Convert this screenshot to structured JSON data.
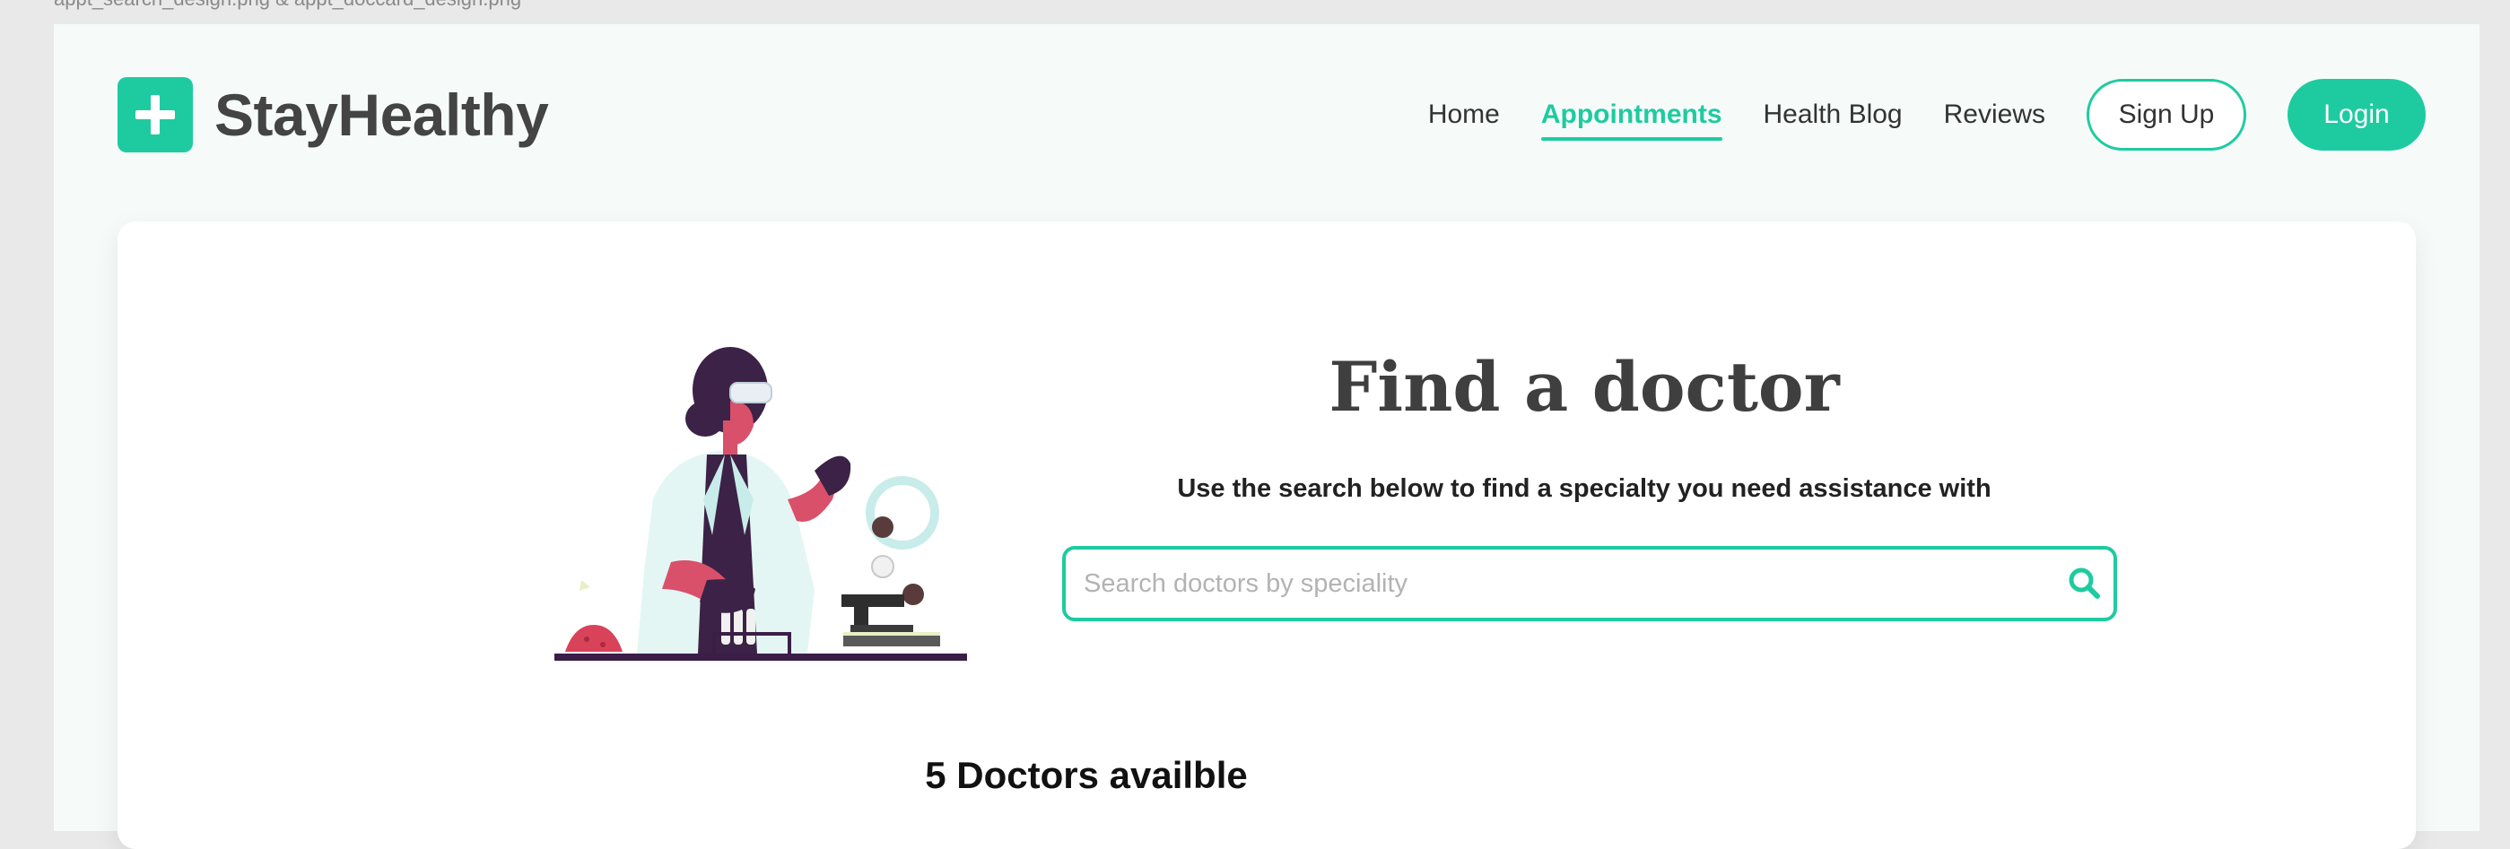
{
  "file_caption": "appt_search_design.png & appt_doccard_design.png",
  "brand": {
    "name": "StayHealthy"
  },
  "nav": {
    "items": [
      {
        "label": "Home",
        "active": false
      },
      {
        "label": "Appointments",
        "active": true
      },
      {
        "label": "Health Blog",
        "active": false
      },
      {
        "label": "Reviews",
        "active": false
      }
    ],
    "signup_label": "Sign Up",
    "login_label": "Login"
  },
  "search_section": {
    "title": "Find a doctor",
    "subtitle": "Use the search below to find a specialty you need assistance with",
    "placeholder": "Search doctors by speciality",
    "value": ""
  },
  "results": {
    "count_text": "5 Doctors availble"
  },
  "colors": {
    "accent": "#1ecba0",
    "text_dark": "#444444",
    "background": "#f6fbfa"
  },
  "icons": {
    "logo": "plus-icon",
    "search": "search-icon"
  }
}
